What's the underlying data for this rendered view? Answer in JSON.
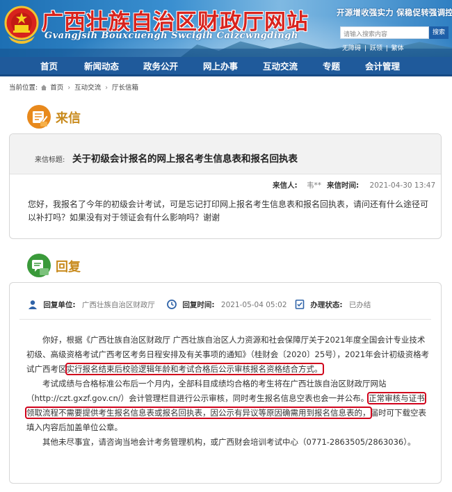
{
  "header": {
    "site_title": "广西壮族自治区财政厅网站",
    "site_subtitle": "Gvangjsih Bouxcuengh Swcigih Caizcwngdingh",
    "slogan": "开源增收强实力   保稳促转强调控",
    "search_placeholder": "请输入搜索内容",
    "search_button": "搜索",
    "quick_links": [
      "无障碍",
      "|",
      "跃领",
      "|",
      "繁体"
    ]
  },
  "nav": {
    "items": [
      "首页",
      "新闻动态",
      "政务公开",
      "网上办事",
      "互动交流",
      "专题",
      "会计管理"
    ]
  },
  "breadcrumb": {
    "label": "当前位置:",
    "items": [
      "首页",
      "互动交流",
      "厅长信箱"
    ]
  },
  "letter": {
    "section_label": "来信",
    "title_label": "来信标题:",
    "title": "关于初级会计报名的网上报名考生信息表和报名回执表",
    "sender_label": "来信人:",
    "sender": "韦**",
    "time_label": "来信时间:",
    "time": "2021-04-30 13:47",
    "body": "您好，我报名了今年的初级会计考试，可是忘记打印网上报名考生信息表和报名回执表，请问还有什么途径可以补打吗？如果没有对于领证会有什么影响吗？谢谢"
  },
  "reply": {
    "section_label": "回复",
    "unit_label": "回复单位:",
    "unit": "广西壮族自治区财政厅",
    "time_label": "回复时间:",
    "time": "2021-05-04 05:02",
    "status_label": "办理状态:",
    "status": "已办结",
    "p1_a": "你好，根据《广西壮族自治区财政厅 广西壮族自治区人力资源和社会保障厅关于2021年度全国会计专业技术初级、高级资格考试广西考区考务日程安排及有关事项的通知》（桂财会〔2020〕25号），2021年会计初级资格考试广西考区",
    "p1_hl": "实行报名结束后校验逻辑年龄和考试合格后公示审核报名资格结合方式。",
    "p2_a": "考试成绩与合格标准公布后一个月内，全部科目成绩均合格的考生将在广西壮族自治区财政厅网站（http://czt.gxzf.gov.cn/）会计管理栏目进行公示审核，同时考生报名信息空表也会一并公布。",
    "p2_hl1": "正常审核与证书",
    "p2_hl2": "领取流程不需要提供考生报名信息表或报名回执表，因公示有异议等原因确需用到报名信息表的，",
    "p2_b": "届时可下载空表填入内容后加盖单位公章。",
    "p3": "其他未尽事宜，请咨询当地会计考务管理机构，或广西财会培训考试中心（0771-2863505/2863036）。"
  },
  "colors": {
    "nav_bg": "#1f5a9b",
    "title_red": "#d8231d",
    "section_gold": "#c88a1c",
    "icon_green": "#3a9a3a",
    "icon_orange": "#e8891c",
    "highlight_red": "#d0021b"
  }
}
